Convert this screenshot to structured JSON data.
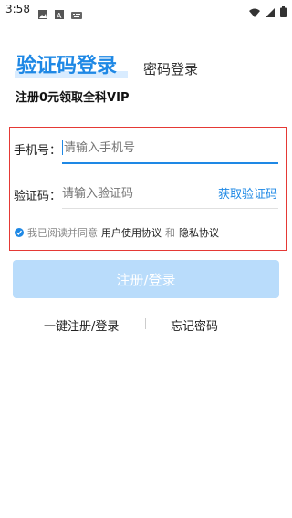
{
  "status_bar": {
    "time": "3:58",
    "left_icons": [
      "image-icon",
      "a-icon",
      "keyboard-icon"
    ],
    "right_icons": [
      "wifi-icon",
      "signal-icon",
      "battery-icon"
    ]
  },
  "header": {
    "title": "验证码登录",
    "alt_login": "密码登录",
    "promo": "注册0元领取全科VIP"
  },
  "form": {
    "phone_label": "手机号：",
    "phone_placeholder": "请输入手机号",
    "code_label": "验证码：",
    "code_placeholder": "请输入验证码",
    "get_code": "获取验证码"
  },
  "agreement": {
    "prefix": "我已阅读并同意",
    "user_agreement": "用户使用协议",
    "and": "和",
    "privacy": "隐私协议"
  },
  "actions": {
    "submit": "注册/登录",
    "one_click": "一键注册/登录",
    "forgot": "忘记密码"
  },
  "colors": {
    "accent": "#1e88e5",
    "highlight_border": "#e53935",
    "button_disabled": "#b9dcfb"
  }
}
